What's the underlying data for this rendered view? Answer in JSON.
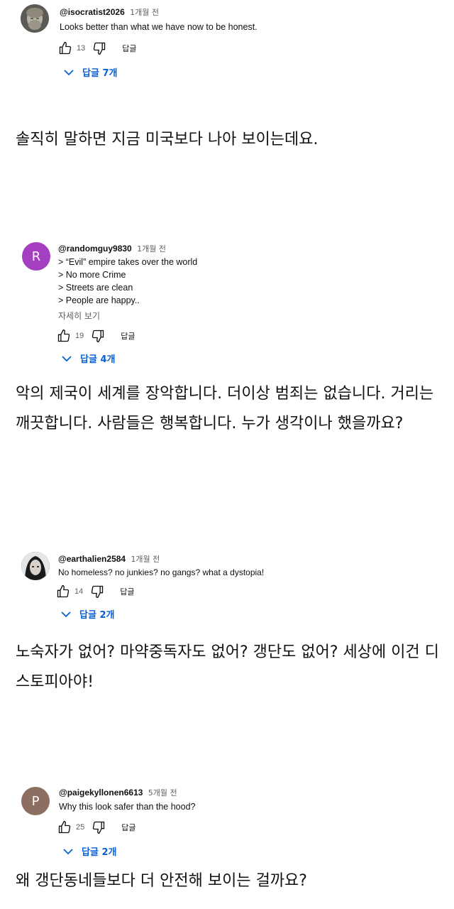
{
  "comments": [
    {
      "handle": "@isocratist2026",
      "time": "1개월 전",
      "lines": [
        "Looks better than what we have now to be honest."
      ],
      "likes": "13",
      "reply_label": "답글",
      "replies_label": "답글 7개",
      "avatar_icon": "statue-avatar-icon"
    },
    {
      "handle": "@randomguy9830",
      "time": "1개월 전",
      "lines": [
        "> “Evil” empire takes over the world",
        "> No more Crime",
        "> Streets are clean",
        "> People are happy.."
      ],
      "more_label": "자세히 보기",
      "likes": "19",
      "reply_label": "답글",
      "replies_label": "답글 4개",
      "avatar_letter": "R",
      "avatar_color": "#a33fc0"
    },
    {
      "handle": "@earthalien2584",
      "time": "1개월 전",
      "lines": [
        "No homeless? no junkies? no gangs? what a dystopia!"
      ],
      "likes": "14",
      "reply_label": "답글",
      "replies_label": "답글 2개",
      "avatar_icon": "portrait-avatar-icon"
    },
    {
      "handle": "@paigekyllonen6613",
      "time": "5개월 전",
      "lines": [
        "Why this look safer than the hood?"
      ],
      "likes": "25",
      "reply_label": "답글",
      "replies_label": "답글 2개",
      "avatar_letter": "P",
      "avatar_color": "#8d6e63"
    }
  ],
  "translations": [
    "솔직히 말하면 지금 미국보다 나아 보이는데요.",
    "악의 제국이 세계를 장악합니다. 더이상 범죄는 없습니다. 거리는 깨끗합니다. 사람들은 행복합니다. 누가 생각이나 했을까요?",
    "노숙자가 없어? 마약중독자도 없어? 갱단도 없어? 세상에 이건 디스토피아야!",
    "왜 갱단동네들보다 더 안전해 보이는 걸까요?"
  ]
}
